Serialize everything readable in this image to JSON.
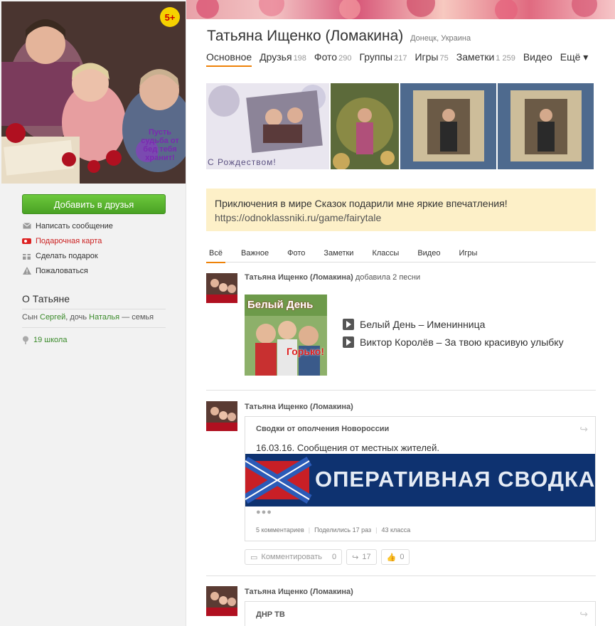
{
  "profile": {
    "name": "Татьяна Ищенко (Ломакина)",
    "location": "Донецк, Украина",
    "age_badge": "5+",
    "avatar_caption": "Пусть судьба от бед тебя хранит!"
  },
  "nav": {
    "tabs": [
      {
        "label": "Основное",
        "count": ""
      },
      {
        "label": "Друзья",
        "count": "198"
      },
      {
        "label": "Фото",
        "count": "290"
      },
      {
        "label": "Группы",
        "count": "217"
      },
      {
        "label": "Игры",
        "count": "75"
      },
      {
        "label": "Заметки",
        "count": "1 259"
      },
      {
        "label": "Видео",
        "count": ""
      },
      {
        "label": "Ещё ▾",
        "count": ""
      }
    ]
  },
  "photos": {
    "first_caption": "С Рождеством!"
  },
  "sidebar": {
    "add_friend": "Добавить в друзья",
    "actions": [
      {
        "label": "Написать сообщение",
        "icon": "envelope-icon"
      },
      {
        "label": "Подарочная карта",
        "icon": "gift-card-icon"
      },
      {
        "label": "Сделать подарок",
        "icon": "gift-icon"
      },
      {
        "label": "Пожаловаться",
        "icon": "warning-icon"
      }
    ],
    "about_title": "О Татьяне",
    "family": {
      "son_prefix": "Сын",
      "son": "Сергей",
      "daughter_prefix": ", дочь",
      "daughter": "Наталья",
      "suffix": "— семья"
    },
    "school": "19 школа"
  },
  "notice": {
    "text": "Приключения в мире Сказок подарили мне яркие впечатления!",
    "url": "https://odnoklassniki.ru/game/fairytale"
  },
  "feed_tabs": [
    "Всё",
    "Важное",
    "Фото",
    "Заметки",
    "Классы",
    "Видео",
    "Игры"
  ],
  "posts": {
    "p1": {
      "author": "Татьяна Ищенко (Ломакина)",
      "action": "добавила 2 песни",
      "album_title": "Белый День",
      "album_subtitle": "Горько!",
      "tracks": [
        "Белый День – Именинница",
        "Виктор Королёв – За твою красивую улыбку"
      ]
    },
    "p2": {
      "author": "Татьяна Ищенко (Ломакина)",
      "card_title": "Сводки от ополчения Новороссии",
      "card_text": "16.03.16. Сообщения от местных жителей.",
      "banner_text": "ОПЕРАТИВНАЯ СВОДКА",
      "comments": "5 комментариев",
      "shared": "Поделились 17 раз",
      "likes_text": "43 класса",
      "comment_btn": "Комментировать",
      "comment_count": "0",
      "share_count": "17",
      "like_count": "0"
    },
    "p3": {
      "author": "Татьяна Ищенко (Ломакина)",
      "card_title": "ДНР ТВ"
    }
  }
}
